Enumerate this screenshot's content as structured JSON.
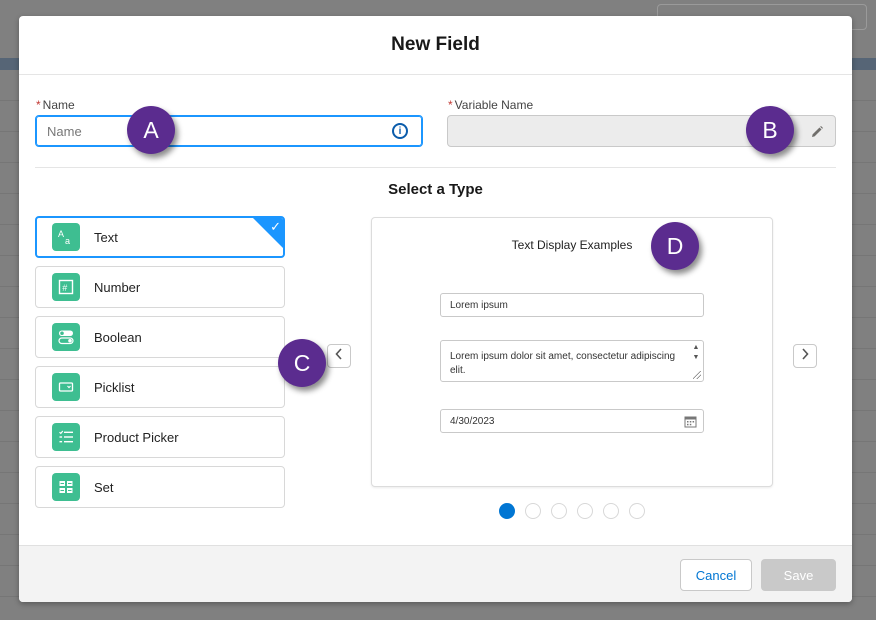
{
  "modal": {
    "title": "New Field"
  },
  "fields": {
    "name_label": "Name",
    "name_placeholder": "Name",
    "required_marker": "*",
    "variable_label": "Variable Name"
  },
  "section": {
    "title": "Select a Type"
  },
  "types": [
    {
      "label": "Text",
      "icon": "text-type-icon"
    },
    {
      "label": "Number",
      "icon": "number-type-icon"
    },
    {
      "label": "Boolean",
      "icon": "toggle-type-icon"
    },
    {
      "label": "Picklist",
      "icon": "picklist-type-icon"
    },
    {
      "label": "Product Picker",
      "icon": "product-picker-type-icon"
    },
    {
      "label": "Set",
      "icon": "set-type-icon"
    }
  ],
  "preview": {
    "title": "Text Display Examples",
    "text_value": "Lorem ipsum",
    "textarea_value": "Lorem ipsum dolor sit amet, consectetur adipiscing elit.",
    "date_value": "4/30/2023"
  },
  "carousel": {
    "page_count": 6,
    "active_index": 0
  },
  "footer": {
    "cancel_label": "Cancel",
    "save_label": "Save"
  },
  "callouts": {
    "a": "A",
    "b": "B",
    "c": "C",
    "d": "D"
  },
  "colors": {
    "brand": "#0176d3",
    "accent_focus": "#1b96ff",
    "type_icon_bg": "#3ebe91",
    "callout_bg": "#5b2c8f",
    "required": "#c23934"
  }
}
